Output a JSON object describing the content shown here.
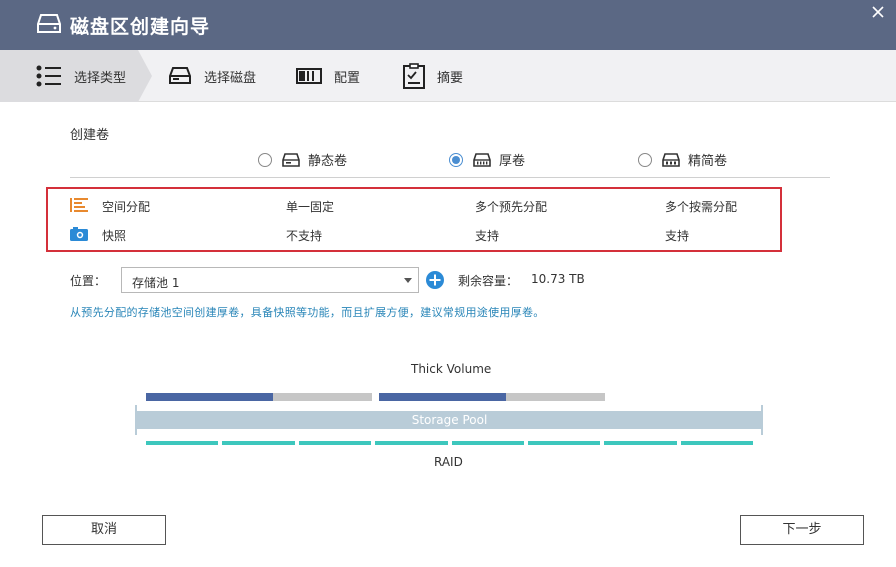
{
  "window": {
    "title": "磁盘区创建向导"
  },
  "steps": [
    {
      "label": "选择类型",
      "icon": "list-icon",
      "active": true
    },
    {
      "label": "选择磁盘",
      "icon": "disk-icon",
      "active": false
    },
    {
      "label": "配置",
      "icon": "config-icon",
      "active": false
    },
    {
      "label": "摘要",
      "icon": "summary-icon",
      "active": false
    }
  ],
  "create": {
    "label": "创建卷",
    "options": [
      {
        "label": "静态卷",
        "icon": "static-volume-icon",
        "selected": false
      },
      {
        "label": "厚卷",
        "icon": "thick-volume-icon",
        "selected": true
      },
      {
        "label": "精简卷",
        "icon": "thin-volume-icon",
        "selected": false
      }
    ]
  },
  "features": [
    {
      "icon": "allocation-icon",
      "name": "空间分配",
      "static": "单一固定",
      "thick": "多个预先分配",
      "thin": "多个按需分配"
    },
    {
      "icon": "snapshot-icon",
      "name": "快照",
      "static": "不支持",
      "thick": "支持",
      "thin": "支持"
    }
  ],
  "location": {
    "label": "位置：",
    "selected": "存储池 1",
    "capacity_label": "剩余容量：",
    "capacity_value": "10.73 TB"
  },
  "hint": "从预先分配的存储池空间创建厚卷，具备快照等功能，而且扩展方便，建议常规用途使用厚卷。",
  "diagram": {
    "title": "Thick Volume",
    "pool_label": "Storage Pool",
    "raid_label": "RAID",
    "volumes": [
      {
        "used_fraction": 0.56
      },
      {
        "used_fraction": 0.56
      }
    ],
    "raid_segments": 8
  },
  "buttons": {
    "cancel": "取消",
    "next": "下一步"
  },
  "colors": {
    "titlebar": "#5b6884",
    "accent": "#4b8ed1",
    "highlight": "#d4303a",
    "used": "#4a66a3",
    "free": "#c6c6c6",
    "raid": "#3dc7bd",
    "pool": "#b9ccd8"
  }
}
